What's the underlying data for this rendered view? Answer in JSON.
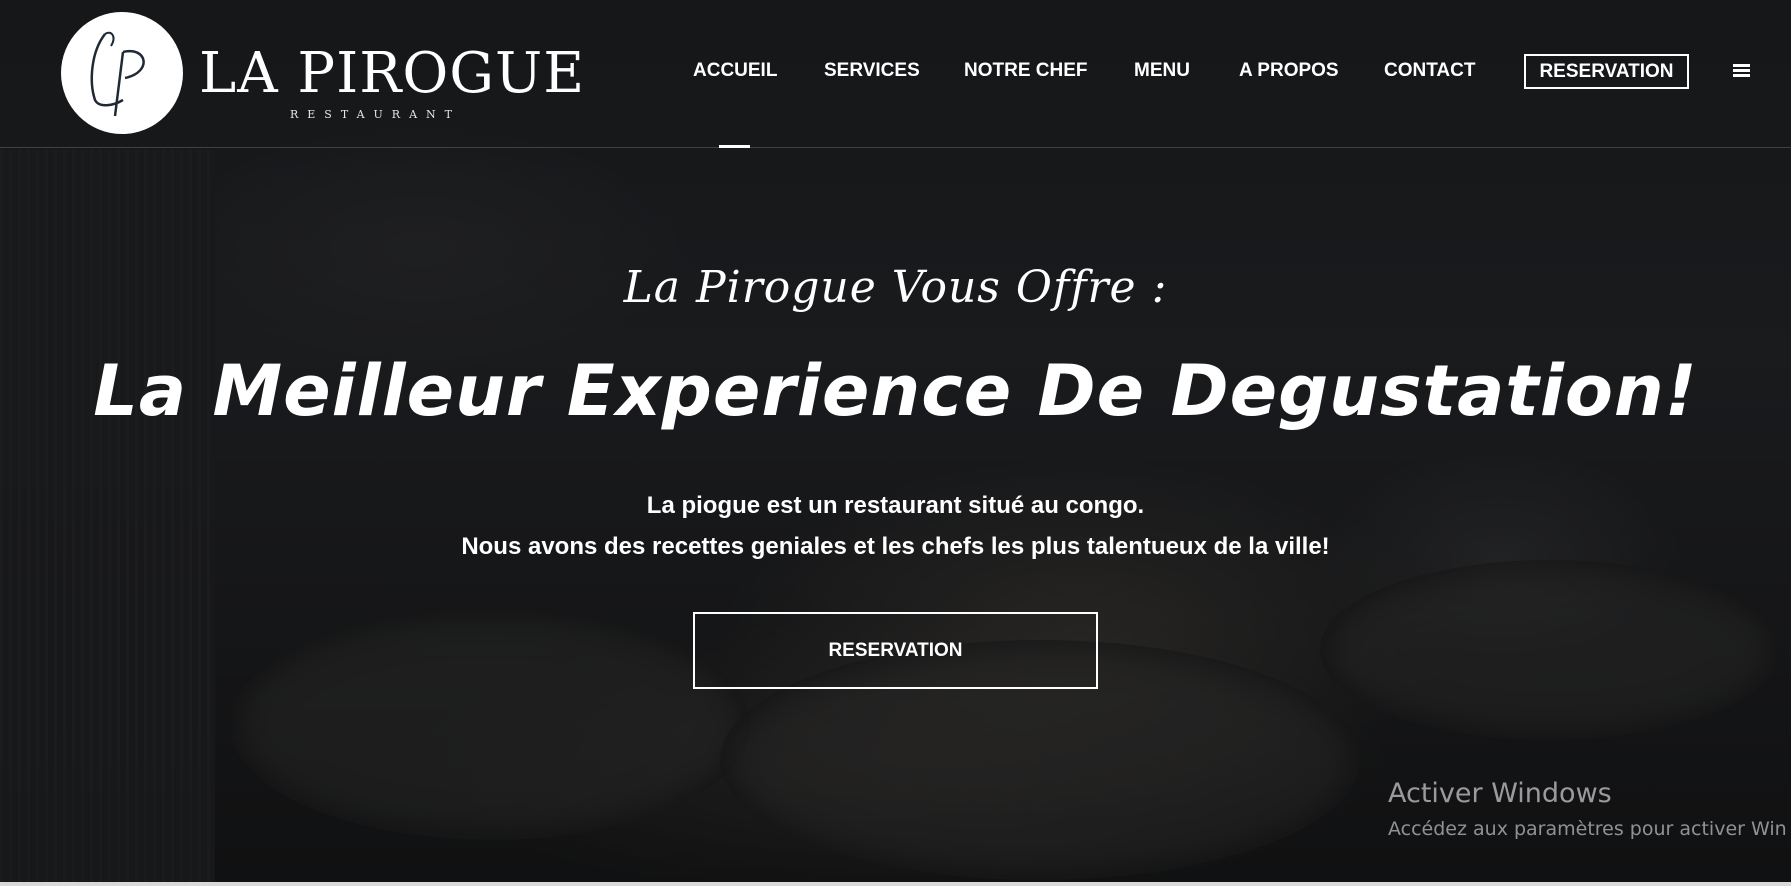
{
  "brand": {
    "logo_monogram": "LP",
    "name": "LA PIROGUE",
    "subtitle": "RESTAURANT"
  },
  "nav": {
    "items": [
      {
        "label": "ACCUEIL",
        "active": true
      },
      {
        "label": "SERVICES",
        "active": false
      },
      {
        "label": "NOTRE CHEF",
        "active": false
      },
      {
        "label": "MENU",
        "active": false
      },
      {
        "label": "A PROPOS",
        "active": false
      },
      {
        "label": "CONTACT",
        "active": false
      }
    ],
    "reservation_label": "RESERVATION",
    "menu_icon": "hamburger-icon"
  },
  "hero": {
    "kicker": "La Pirogue Vous Offre :",
    "title": "La Meilleur Experience De Degustation!",
    "line1": "La piogue est un restaurant situé au congo.",
    "line2": "Nous avons des recettes geniales et les chefs les plus talentueux de la ville!",
    "button_label": "RESERVATION"
  },
  "watermark": {
    "title": "Activer Windows",
    "subtitle": "Accédez aux paramètres pour activer Win"
  },
  "colors": {
    "text": "#ffffff",
    "background": "#1b1d1e",
    "logo_ink": "#1f2a36"
  }
}
